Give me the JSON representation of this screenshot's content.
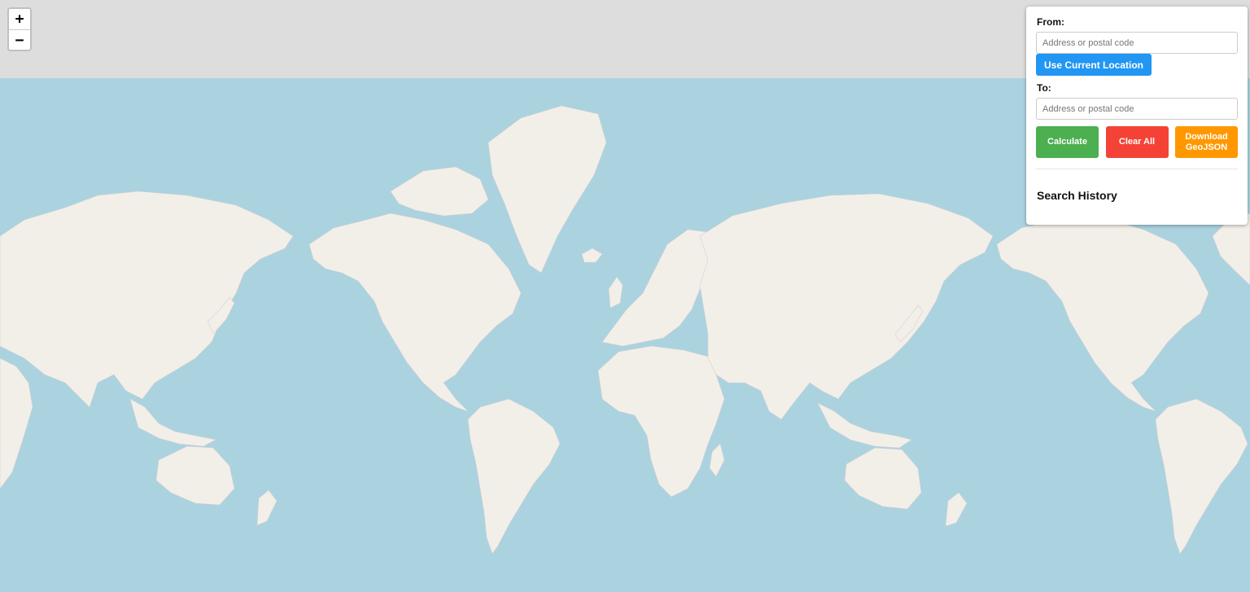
{
  "map": {
    "zoom_in_label": "+",
    "zoom_out_label": "−",
    "colors": {
      "ocean": "#aad3df",
      "land": "#f2efe9",
      "background": "#dddddd",
      "border": "#c9a3c4"
    }
  },
  "panel": {
    "from_label": "From:",
    "from_placeholder": "Address or postal code",
    "from_value": "",
    "use_location_label": "Use Current Location",
    "to_label": "To:",
    "to_placeholder": "Address or postal code",
    "to_value": "",
    "calculate_label": "Calculate",
    "clear_label": "Clear All",
    "download_label": "Download GeoJSON",
    "history_title": "Search History",
    "colors": {
      "location_button": "#2196F3",
      "calculate_button": "#4CAF50",
      "clear_button": "#f44336",
      "download_button": "#FF9800"
    }
  }
}
